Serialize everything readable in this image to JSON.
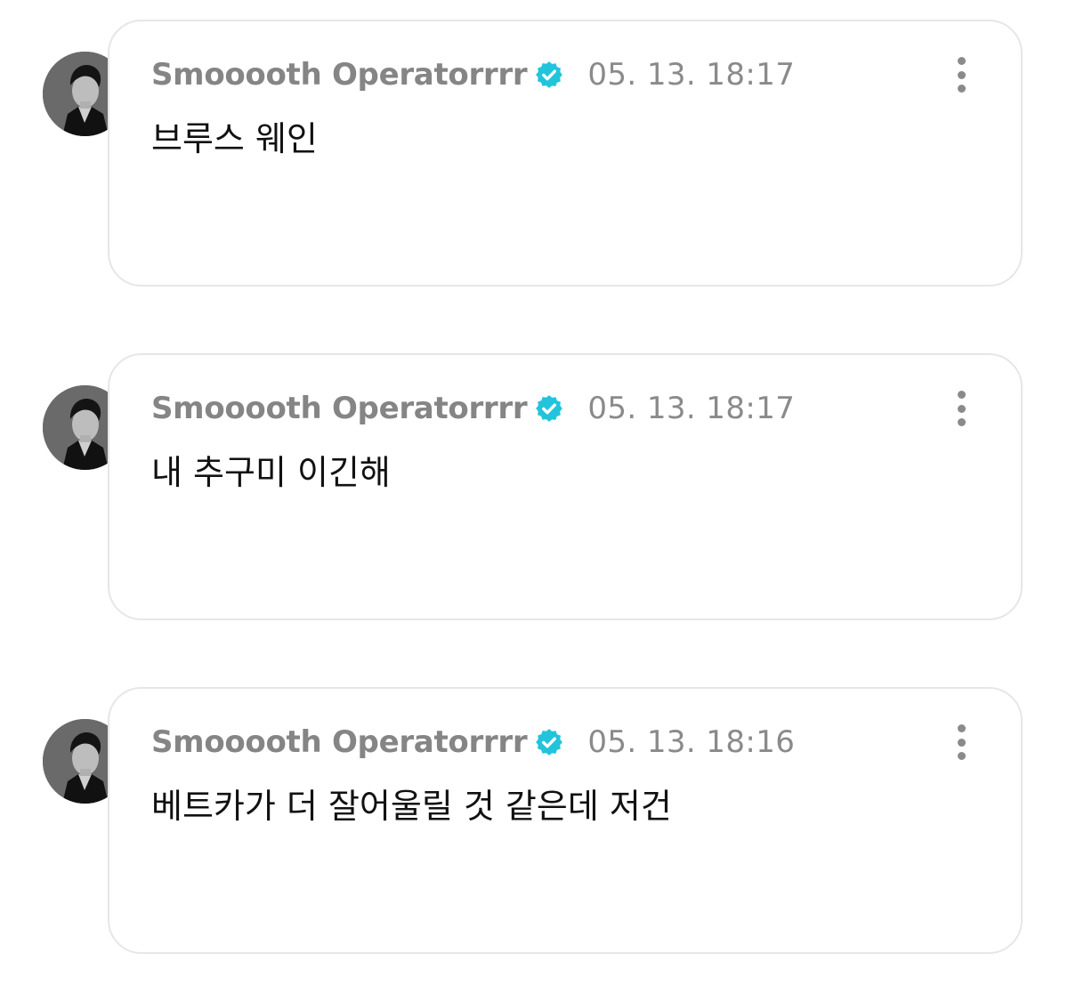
{
  "posts": [
    {
      "author": "Smooooth Operatorrrr",
      "timestamp": "05. 13. 18:17",
      "text": "브루스 웨인",
      "verified": true
    },
    {
      "author": "Smooooth Operatorrrr",
      "timestamp": "05. 13. 18:17",
      "text": "내 추구미 이긴해",
      "verified": true
    },
    {
      "author": "Smooooth Operatorrrr",
      "timestamp": "05. 13. 18:16",
      "text": "베트카가 더 잘어울릴 것 같은데 저건",
      "verified": true
    }
  ],
  "icons": {
    "verified": "verified-badge-icon",
    "more": "more-vertical-icon"
  },
  "colors": {
    "verified_badge": "#22c4dc",
    "author_text": "#858585",
    "timestamp_text": "#8a8a8a",
    "message_text": "#111111",
    "card_border": "#e6e6ea"
  }
}
